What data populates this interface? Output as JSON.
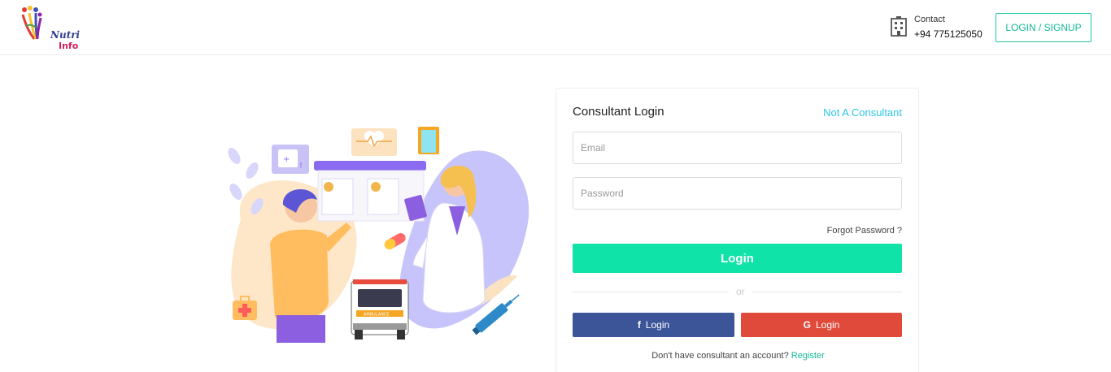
{
  "header": {
    "logo": {
      "text_top": "Nutri",
      "text_bottom": "Info"
    },
    "contact": {
      "label": "Contact",
      "phone": "+94 775125050",
      "icon": "building-icon"
    },
    "login_signup_label": "LOGIN / SIGNUP"
  },
  "illustration": {
    "ambulance_text": "AMBULANCE"
  },
  "form": {
    "title": "Consultant Login",
    "not_consultant_label": "Not A Consultant",
    "email_placeholder": "Email",
    "password_placeholder": "Password",
    "forgot_label": "Forgot Password ?",
    "login_label": "Login",
    "or_label": "or",
    "facebook_label": "Login",
    "facebook_icon": "f",
    "google_label": "Login",
    "google_icon": "G",
    "register_prompt": "Don't have consultant an account?",
    "register_link": "Register"
  },
  "colors": {
    "accent_green": "#0fe3a8",
    "link_cyan": "#2dc6e6",
    "facebook_blue": "#3b5598",
    "google_red": "#df4a3b",
    "illustration_purple": "#8b6cf0"
  }
}
